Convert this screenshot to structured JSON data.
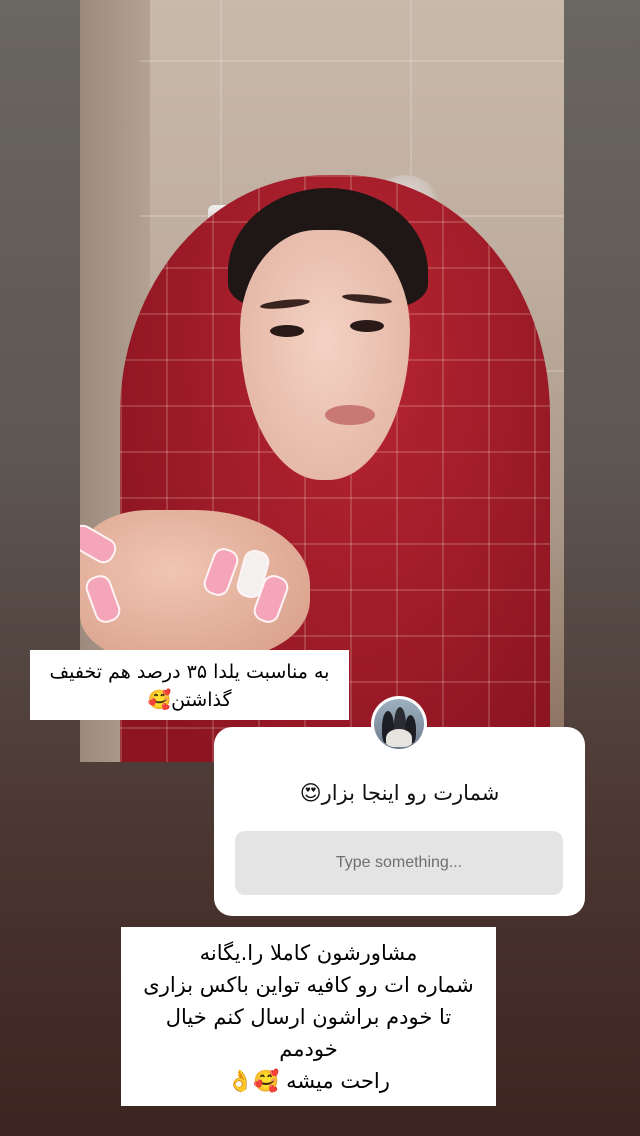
{
  "story": {
    "caption_top": "به مناسبت یلدا ۳۵ درصد هم تخفیف گذاشتن🥰",
    "question_sticker": {
      "prompt": "شمارت رو اینجا بزار😍",
      "placeholder": "Type something..."
    },
    "caption_bottom": {
      "lines": [
        "مشاورشون کاملا را.یگانه",
        "شماره ات رو کافیه تواین باکس بزاری",
        "تا خودم براشون ارسال کنم خیال",
        "خودمم",
        "راحت میشه 🥰👌"
      ]
    }
  }
}
